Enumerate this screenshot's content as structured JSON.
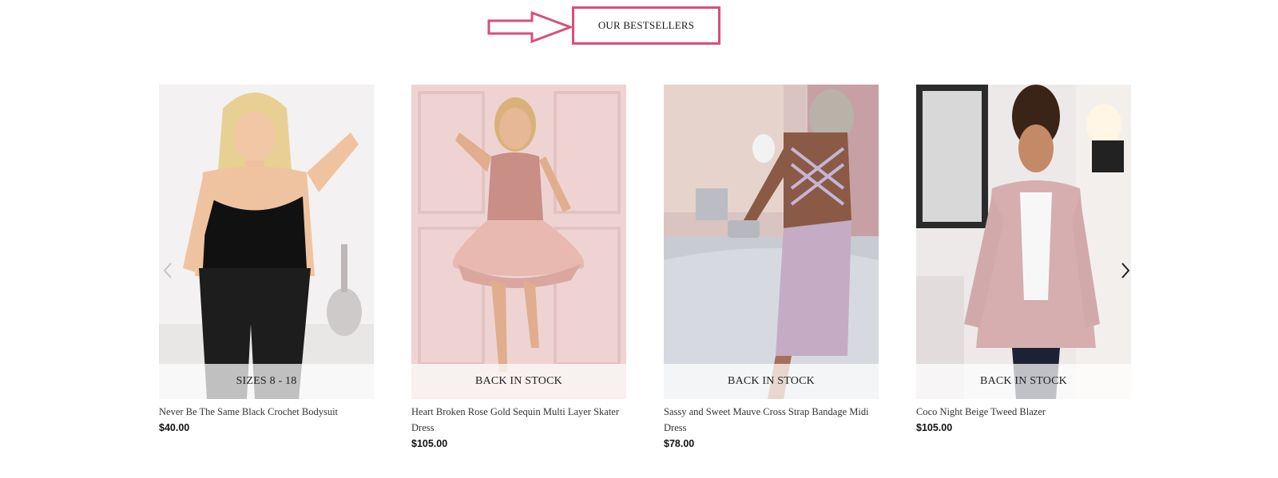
{
  "section": {
    "heading": "OUR BESTSELLERS",
    "accent_color": "#d94f7a"
  },
  "carousel": {
    "prev_icon": "chevron-left-icon",
    "next_icon": "chevron-right-icon",
    "products": [
      {
        "badge": "SIZES 8 - 18",
        "title": "Never Be The Same Black Crochet Bodysuit",
        "price": "$40.00"
      },
      {
        "badge": "BACK IN STOCK",
        "title": "Heart Broken Rose Gold Sequin Multi Layer Skater Dress",
        "price": "$105.00"
      },
      {
        "badge": "BACK IN STOCK",
        "title": "Sassy and Sweet Mauve Cross Strap Bandage Midi Dress",
        "price": "$78.00"
      },
      {
        "badge": "BACK IN STOCK",
        "title": "Coco Night Beige Tweed Blazer",
        "price": "$105.00"
      }
    ]
  }
}
